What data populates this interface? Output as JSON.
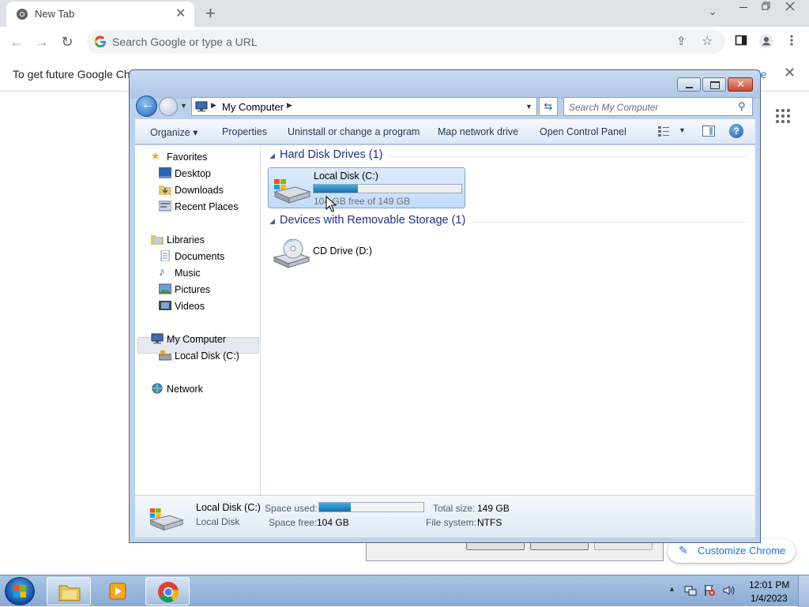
{
  "chrome": {
    "tab_title": "New Tab",
    "tab_close": "✕",
    "new_tab": "+",
    "tab_search": "⌄",
    "omnibox_placeholder": "Search Google or type a URL",
    "infobar_message": "To get future Google Chro",
    "infobar_more": "re",
    "infobar_close": "✕",
    "customize_label": "Customize Chrome"
  },
  "explorer": {
    "address_crumb": "My Computer",
    "search_placeholder": "Search My Computer",
    "commands": {
      "organize": "Organize ▾",
      "properties": "Properties",
      "uninstall": "Uninstall or change a program",
      "map_drive": "Map network drive",
      "control_panel": "Open Control Panel"
    },
    "nav": {
      "favorites": "Favorites",
      "desktop": "Desktop",
      "downloads": "Downloads",
      "recent_places": "Recent Places",
      "libraries": "Libraries",
      "documents": "Documents",
      "music": "Music",
      "pictures": "Pictures",
      "videos": "Videos",
      "my_computer": "My Computer",
      "local_disk": "Local Disk (C:)",
      "network": "Network"
    },
    "groups": {
      "hard_disks": "Hard Disk Drives (1)",
      "removable": "Devices with Removable Storage (1)"
    },
    "drives": {
      "c_name": "Local Disk (C:)",
      "c_free": "104 GB free of 149 GB",
      "c_used_fraction": 0.3,
      "d_name": "CD Drive (D:)"
    },
    "details": {
      "name": "Local Disk (C:)",
      "type": "Local Disk",
      "space_used_label": "Space used:",
      "space_free_label": "Space free:",
      "space_free_value": "104 GB",
      "total_size_label": "Total size:",
      "total_size_value": "149 GB",
      "file_system_label": "File system:",
      "file_system_value": "NTFS"
    }
  },
  "taskbar": {
    "time": "12:01 PM",
    "date": "1/4/2023"
  },
  "colors": {
    "chrome_tabbar": "#dee1e6",
    "explorer_frame": "#bcd1ec",
    "link_blue": "#1a73e8",
    "group_header": "#1e3287"
  }
}
